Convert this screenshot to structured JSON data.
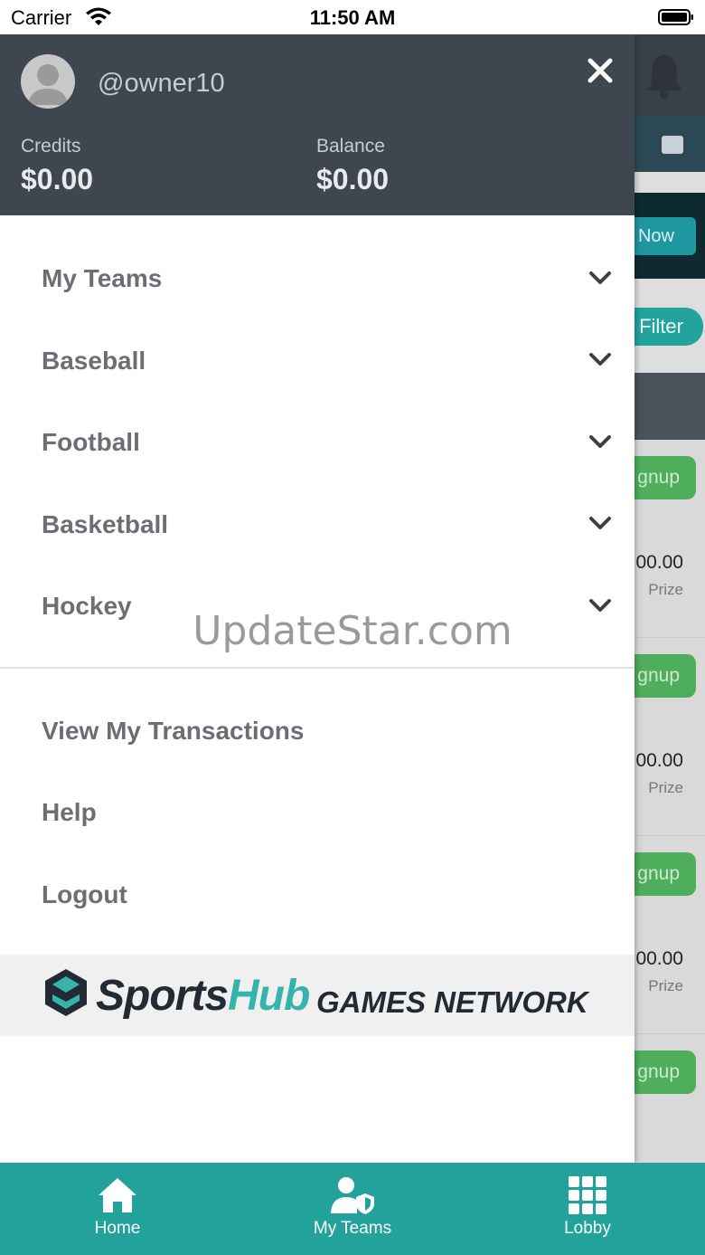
{
  "status_bar": {
    "carrier": "Carrier",
    "time": "11:50 AM"
  },
  "drawer": {
    "username": "@owner10",
    "credits_label": "Credits",
    "credits_value": "$0.00",
    "balance_label": "Balance",
    "balance_value": "$0.00",
    "menu_items": [
      {
        "label": "My Teams"
      },
      {
        "label": "Baseball"
      },
      {
        "label": "Football"
      },
      {
        "label": "Basketball"
      },
      {
        "label": "Hockey"
      }
    ],
    "links": [
      {
        "label": "View My Transactions"
      },
      {
        "label": "Help"
      },
      {
        "label": "Logout"
      }
    ],
    "logo": {
      "sports": "Sports",
      "hub": "Hub",
      "network": "GAMES NETWORK"
    }
  },
  "watermark": "UpdateStar.com",
  "background": {
    "now_button": "Now",
    "filter_button": "Filter",
    "cards": [
      {
        "signup": "gnup",
        "amount": "00.00",
        "prize": "Prize"
      },
      {
        "signup": "gnup",
        "amount": "00.00",
        "prize": "Prize"
      },
      {
        "signup": "gnup",
        "amount": "00.00",
        "prize": "Prize"
      },
      {
        "signup": "gnup",
        "amount": "",
        "prize": ""
      }
    ]
  },
  "tab_bar": {
    "tabs": [
      {
        "label": "Home",
        "icon": "home-icon"
      },
      {
        "label": "My Teams",
        "icon": "user-shield-icon"
      },
      {
        "label": "Lobby",
        "icon": "grid-icon"
      }
    ]
  },
  "colors": {
    "drawer_header": "#3e4650",
    "tab_bar": "#22a29b",
    "menu_text": "#6b6f73",
    "logo_accent": "#36b3ad"
  }
}
